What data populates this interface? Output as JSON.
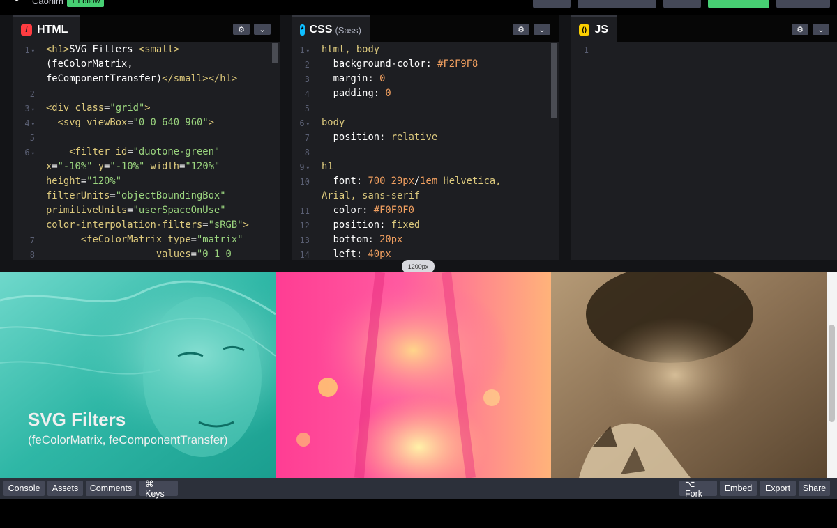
{
  "topbar": {
    "author": "Caonim",
    "follow_label": "+ Follow"
  },
  "editors": {
    "html": {
      "title": "HTML",
      "icon": "slash-icon",
      "icon_color": "#ff3c41",
      "lines": [
        {
          "n": "1",
          "fold": true
        },
        {
          "n": "2"
        },
        {
          "n": "3",
          "fold": true
        },
        {
          "n": "4",
          "fold": true
        },
        {
          "n": "5"
        },
        {
          "n": "6",
          "fold": true
        },
        {
          "n": "7"
        },
        {
          "n": "8"
        }
      ],
      "code": {
        "l1a": "<h1>",
        "l1b": "SVG Filters ",
        "l1c": "<small>",
        "l1d": "(feColorMatrix,",
        "l1e": "feComponentTransfer)",
        "l1f": "</small></h1>",
        "l3a": "<div ",
        "l3b": "class",
        "l3c": "=",
        "l3d": "\"grid\"",
        "l3e": ">",
        "l4a": "  <svg ",
        "l4b": "viewBox",
        "l4c": "=",
        "l4d": "\"0 0 640 960\"",
        "l4e": ">",
        "l6a": "    <filter ",
        "l6b": "id",
        "l6c": "=",
        "l6d": "\"duotone-green\"",
        "l6e": "x",
        "l6f": "\"-10%\"",
        "l6g": " y",
        "l6h": "\"-10%\"",
        "l6i": " width",
        "l6j": "\"120%\"",
        "l6k": "height",
        "l6l": "\"120%\"",
        "l6m": "filterUnits",
        "l6n": "\"objectBoundingBox\"",
        "l6o": "primitiveUnits",
        "l6p": "\"userSpaceOnUse\"",
        "l6q": "color-interpolation-filters",
        "l6r": "\"sRGB\"",
        "l6s": ">",
        "l7a": "      <feColorMatrix ",
        "l7b": "type",
        "l7c": "\"matrix\"",
        "l8a": "                   values",
        "l8b": "\"0 1 0"
      }
    },
    "css": {
      "title": "CSS",
      "subtitle": "(Sass)",
      "icon": "asterisk-icon",
      "icon_color": "#0ebeff",
      "lines": [
        {
          "n": "1",
          "fold": true
        },
        {
          "n": "2"
        },
        {
          "n": "3"
        },
        {
          "n": "4"
        },
        {
          "n": "5"
        },
        {
          "n": "6",
          "fold": true
        },
        {
          "n": "7"
        },
        {
          "n": "8"
        },
        {
          "n": "9",
          "fold": true
        },
        {
          "n": "10"
        },
        {
          "n": "11"
        },
        {
          "n": "12"
        },
        {
          "n": "13"
        },
        {
          "n": "14"
        }
      ],
      "code": {
        "l1": "html, body",
        "l2a": "  background-color: ",
        "l2b": "#F2F9F8",
        "l3a": "  margin: ",
        "l3b": "0",
        "l4a": "  padding: ",
        "l4b": "0",
        "l6": "body",
        "l7a": "  position: ",
        "l7b": "relative",
        "l9": "h1",
        "l10a": "  font: ",
        "l10b": "700 29px",
        "l10c": "/",
        "l10d": "1em",
        "l10e": " Helvetica,",
        "l10f": "Arial, sans-serif",
        "l11a": "  color: ",
        "l11b": "#F0F0F0",
        "l12a": "  position: ",
        "l12b": "fixed",
        "l13a": "  bottom: ",
        "l13b": "20px",
        "l14a": "  left: ",
        "l14b": "40px"
      }
    },
    "js": {
      "title": "JS",
      "icon": "braces-icon",
      "icon_color": "#fcd000",
      "lines": [
        {
          "n": "1"
        }
      ]
    },
    "settings_icon": "gear-icon",
    "collapse_icon": "chevron-down-icon"
  },
  "resize": {
    "width_label": "1200px"
  },
  "preview": {
    "title": "SVG Filters",
    "subtitle": "(feColorMatrix, feComponentTransfer)",
    "photos": [
      {
        "name": "duotone-green-photo",
        "from": "#12998a",
        "to": "#7fe3d5"
      },
      {
        "name": "duotone-pink-photo",
        "from": "#ff2a8a",
        "to": "#ffd27a"
      },
      {
        "name": "sepia-photo",
        "from": "#3d2c17",
        "to": "#b59a76"
      }
    ]
  },
  "bottombar": {
    "console": "Console",
    "assets": "Assets",
    "comments": "Comments",
    "keys": "⌘ Keys",
    "fork": "⌥ Fork",
    "embed": "Embed",
    "export": "Export",
    "share": "Share"
  }
}
